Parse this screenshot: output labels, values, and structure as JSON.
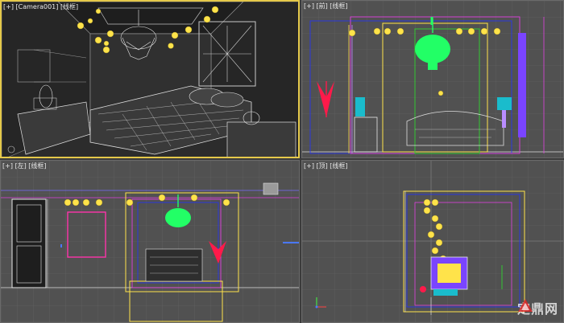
{
  "viewports": {
    "perspective": {
      "label": "[+] [Camera001] [线框]"
    },
    "front": {
      "label": "[+] [前] [线框]"
    },
    "left": {
      "label": "[+] [左] [线框]"
    },
    "top": {
      "label": "[+] [顶] [线框]"
    }
  },
  "icons": {
    "axis": "axis-gizmo-icon",
    "logo": "dingding-logo-icon"
  },
  "colors": {
    "viewport_bg": "#515151",
    "grid_line": "#666666",
    "active_border": "#e5c94a",
    "chandelier": "#22ff66",
    "lamp_yellow": "#ffe34a",
    "magenta": "#ff33ff",
    "red_vase": "#ff1a4a",
    "teal": "#1abccc"
  },
  "watermark": {
    "text": "定鼎网"
  }
}
